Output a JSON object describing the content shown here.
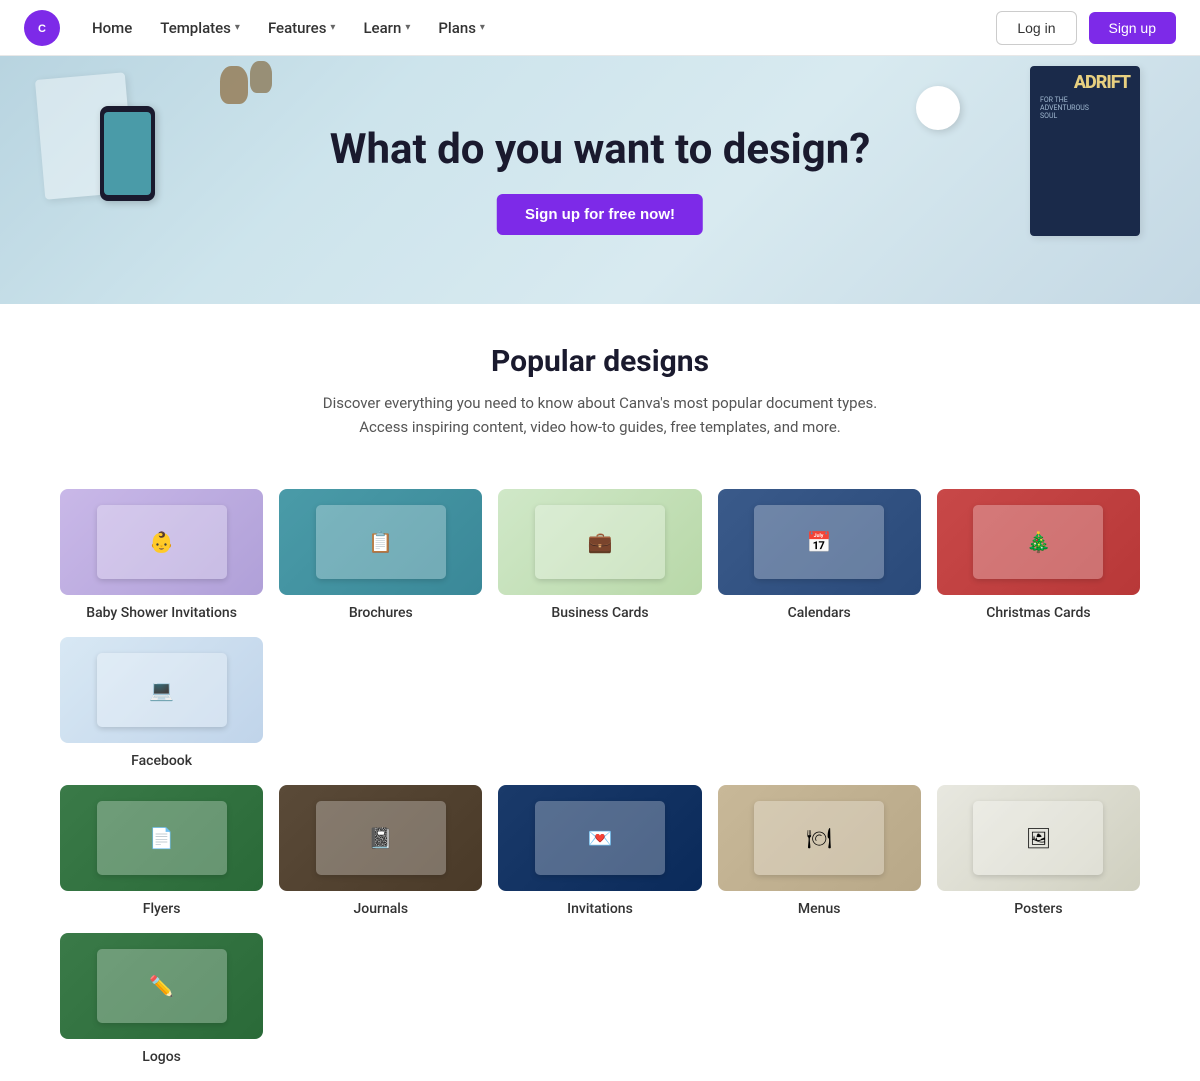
{
  "nav": {
    "logo_alt": "Canva Logo",
    "home_label": "Home",
    "templates_label": "Templates",
    "features_label": "Features",
    "learn_label": "Learn",
    "plans_label": "Plans",
    "login_label": "Log in",
    "signup_label": "Sign up"
  },
  "hero": {
    "title": "What do you want to design?",
    "cta_label": "Sign up for free now!"
  },
  "popular": {
    "title": "Popular designs",
    "description": "Discover everything you need to know about Canva's most popular document types. Access inspiring content, video how-to guides, free templates, and more."
  },
  "design_row1": [
    {
      "id": "baby-shower",
      "label": "Baby Shower Invitations",
      "theme": "baby-shower"
    },
    {
      "id": "brochures",
      "label": "Brochures",
      "theme": "brochure"
    },
    {
      "id": "business-cards",
      "label": "Business Cards",
      "theme": "business-cards"
    },
    {
      "id": "calendars",
      "label": "Calendars",
      "theme": "calendars"
    },
    {
      "id": "christmas-cards",
      "label": "Christmas Cards",
      "theme": "christmas"
    },
    {
      "id": "facebook",
      "label": "Facebook",
      "theme": "facebook"
    }
  ],
  "design_row2": [
    {
      "id": "flyers",
      "label": "Flyers",
      "theme": "flyers"
    },
    {
      "id": "journals",
      "label": "Journals",
      "theme": "journals"
    },
    {
      "id": "invitations2",
      "label": "Invitations",
      "theme": "invitations2"
    },
    {
      "id": "menus",
      "label": "Menus",
      "theme": "menus"
    },
    {
      "id": "posters",
      "label": "Posters",
      "theme": "posters"
    },
    {
      "id": "logos",
      "label": "Logos",
      "theme": "logos"
    }
  ]
}
